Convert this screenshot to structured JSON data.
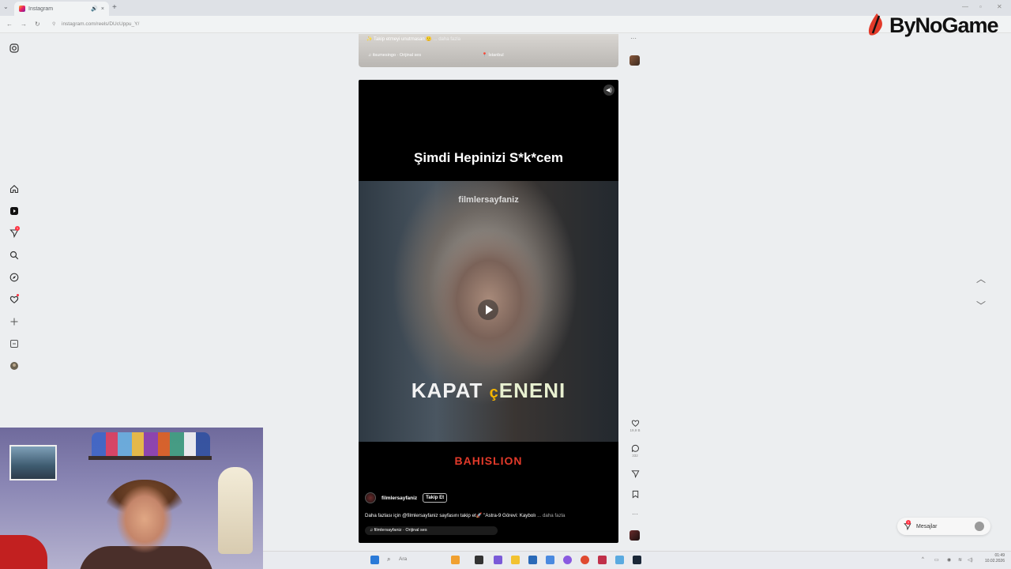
{
  "browser": {
    "tab_title": "Instagram",
    "url": "instagram.com/reels/DUcUppu_Y/",
    "new_tab_symbol": "+",
    "tab_close_symbol": "×",
    "audio_symbol": "🔊"
  },
  "brand": {
    "name": "ByNoGame"
  },
  "sidebar": {
    "notifications_badge": "1",
    "icons": [
      "instagram-icon",
      "home-icon",
      "reels-icon",
      "direct-icon",
      "search-icon",
      "explore-icon",
      "heart-icon",
      "create-icon",
      "more-icon",
      "profile-avatar"
    ]
  },
  "previous_reel": {
    "caption": "✨ Takip etmeyi unutmasan 🙂",
    "caption_more": "... daha fazla",
    "audio": "♫ itsumesingo · Orijinal ses",
    "location": "📍 İstanbul"
  },
  "reel": {
    "top_caption": "Şimdi Hepinizi S*k*cem",
    "watermark": "filmlersayfaniz",
    "subtitle_1": "KAPAT",
    "subtitle_2": "ç",
    "subtitle_3": "ENENI",
    "sponsor": "BAHISLION",
    "author": "filmlersayfaniz",
    "follow_label": "Takip Et",
    "description": "Daha fazlası için @filmlersayfaniz sayfasını takip et🚀 \"Astra-9 Görevi: Kaybolı",
    "description_more": "... daha fazla",
    "audio": "♫ filmlersayfaniz · Orijinal ses",
    "likes": "19,9 B",
    "comments": "332"
  },
  "messages": {
    "label": "Mesajlar",
    "badge": "1"
  },
  "taskbar": {
    "search_placeholder": "Ara",
    "time": "01:49",
    "date": "10.02.2026"
  },
  "colors": {
    "ig_red": "#ff3040",
    "sponsor_red": "#e23a2a",
    "subtitle_yellow": "#f4b400"
  }
}
